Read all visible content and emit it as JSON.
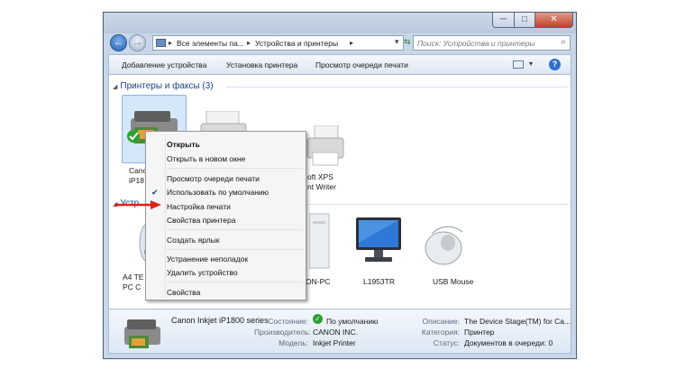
{
  "window": {
    "controls": {
      "minimize": "─",
      "maximize": "□",
      "close": "✕"
    }
  },
  "address": {
    "segments": [
      "Все элементы па...",
      "Устройства и принтеры"
    ],
    "separator": "▸",
    "search_placeholder": "Поиск: Устройства и принтеры"
  },
  "toolbar": {
    "add_device": "Добавление устройства",
    "add_printer": "Установка принтера",
    "view_queue": "Просмотр очереди печати",
    "help": "?"
  },
  "groups": {
    "printers": "Принтеры и факсы (3)",
    "devices": "Устр"
  },
  "printers": [
    {
      "label_lines": [
        "Canon",
        "iP18"
      ]
    },
    {
      "label_lines": [
        "oft XPS",
        "nt Writer"
      ]
    }
  ],
  "devices": [
    {
      "label_lines": [
        "A4 TE",
        "PC C"
      ]
    },
    {
      "label_lines": [
        "ON-PC"
      ]
    },
    {
      "label_lines": [
        "L1953TR"
      ]
    },
    {
      "label_lines": [
        "USB Mouse"
      ]
    }
  ],
  "context_menu": {
    "items": [
      {
        "label": "Открыть",
        "bold": true
      },
      {
        "label": "Открыть в новом окне"
      },
      {
        "label": "Просмотр очереди печати"
      },
      {
        "label": "Использовать по умолчанию",
        "checked": true
      },
      {
        "label": "Настройка печати"
      },
      {
        "label": "Свойства принтера"
      },
      {
        "label": "Создать ярлык"
      },
      {
        "label": "Устранение неполадок"
      },
      {
        "label": "Удалить устройство"
      },
      {
        "label": "Свойства"
      }
    ]
  },
  "details": {
    "name": "Canon Inkjet iP1800 series",
    "state_label": "Состояние:",
    "state_value": "По умолчанию",
    "manufacturer_label": "Производитель:",
    "manufacturer_value": "CANON INC.",
    "model_label": "Модель:",
    "model_value": "Inkjet Printer",
    "description_label": "Описание:",
    "description_value": "The Device Stage(TM) for Ca...",
    "category_label": "Категория:",
    "category_value": "Принтер",
    "status_label": "Статус:",
    "status_value": "Документов в очереди: 0"
  },
  "colors": {
    "accent": "#1c3f86",
    "arrow": "#e0201a",
    "check": "#2fa12f"
  }
}
